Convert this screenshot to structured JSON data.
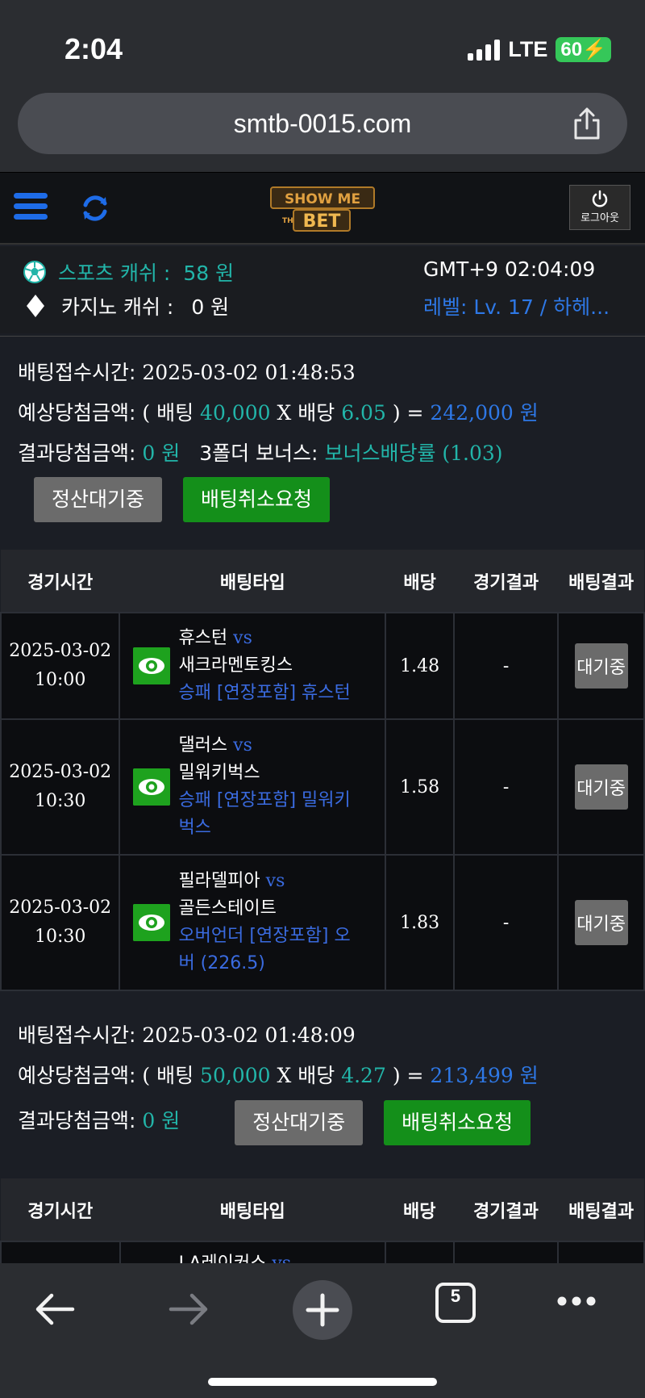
{
  "status_bar": {
    "time": "2:04",
    "network": "LTE",
    "battery": "60"
  },
  "browser": {
    "url": "smtb-0015.com",
    "tab_count": "5"
  },
  "header": {
    "logout_label": "로그아웃",
    "logo_alt": "SHOW ME THE BET"
  },
  "cash": {
    "sports_label": "스포츠 캐쉬 :",
    "sports_value": "58 원",
    "casino_label": "카지노 캐쉬 :",
    "casino_value": "0 원",
    "gmt": "GMT+9 02:04:09",
    "level": "레벨: Lv. 17 / 하헤..."
  },
  "table_headers": [
    "경기시간",
    "배팅타입",
    "배당",
    "경기결과",
    "배팅결과"
  ],
  "bets": [
    {
      "received_label": "배팅접수시간:",
      "received_time": "2025-03-02 01:48:53",
      "expected_label": "예상당첨금액:",
      "expected_open": "( 배팅",
      "stake": "40,000",
      "times": "X 배당",
      "odds": "6.05",
      "expected_close": ") =",
      "expected_win": "242,000 원",
      "result_label": "결과당첨금액:",
      "result_value": "0 원",
      "bonus_label": "3폴더 보너스:",
      "bonus_value": "보너스배당률 (1.03)",
      "settle_button": "정산대기중",
      "cancel_button": "배팅취소요청",
      "rows": [
        {
          "date": "2025-03-02",
          "time": "10:00",
          "home": "휴스턴",
          "vs": "vs",
          "away": "새크라멘토킹스",
          "pick": "승패 [연장포함] 휴스턴",
          "odds": "1.48",
          "result": "-",
          "status": "대기중"
        },
        {
          "date": "2025-03-02",
          "time": "10:30",
          "home": "댈러스",
          "vs": "vs",
          "away": "밀워키벅스",
          "pick": "승패 [연장포함] 밀워키벅스",
          "odds": "1.58",
          "result": "-",
          "status": "대기중"
        },
        {
          "date": "2025-03-02",
          "time": "10:30",
          "home": "필라델피아",
          "vs": "vs",
          "away": "골든스테이트",
          "pick": "오버언더 [연장포함] 오버 (226.5)",
          "odds": "1.83",
          "result": "-",
          "status": "대기중"
        }
      ]
    },
    {
      "received_label": "배팅접수시간:",
      "received_time": "2025-03-02 01:48:09",
      "expected_label": "예상당첨금액:",
      "expected_open": "( 배팅",
      "stake": "50,000",
      "times": "X 배당",
      "odds": "4.27",
      "expected_close": ") =",
      "expected_win": "213,499 원",
      "result_label": "결과당첨금액:",
      "result_value": "0 원",
      "settle_button": "정산대기중",
      "cancel_button": "배팅취소요청",
      "rows": [
        {
          "home": "LA레이커스",
          "vs": "vs"
        }
      ]
    }
  ],
  "colors": {
    "teal": "#22b5a9",
    "blue": "#2e78e6",
    "green_button": "#148f1a",
    "gray_button": "#6b6b6b"
  }
}
